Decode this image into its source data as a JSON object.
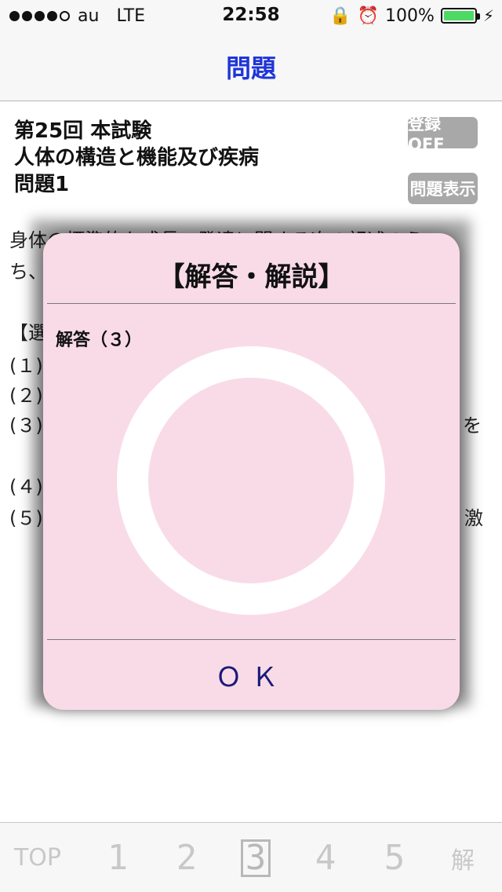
{
  "status_bar": {
    "carrier": "au",
    "network": "LTE",
    "time": "22:58",
    "battery_percent": "100%",
    "signal_bars_filled": 4,
    "signal_bars_total": 5
  },
  "nav": {
    "title": "問題"
  },
  "question": {
    "line1": "第25回 本試験",
    "line2": "人体の構造と機能及び疾病",
    "line3": "問題1",
    "register_button": "登録 OFF",
    "show_button": "問題表示",
    "body_line1": "身体の標準的な成長・発達に関する次の記述のう",
    "body_line2": "ち、",
    "options_header": "【選",
    "opt1": "(１)",
    "opt2": "(２)",
    "opt3": "(３)",
    "opt3_tail": "を",
    "opt4": "(４)",
    "opt5": "(５)",
    "opt5_tail": "激"
  },
  "modal": {
    "title": "【解答・解説】",
    "answer": "解答（３）",
    "ok_label": "ＯＫ"
  },
  "tab_bar": {
    "top": "TOP",
    "n1": "1",
    "n2": "2",
    "n3": "3",
    "n4": "4",
    "n5": "5",
    "kai": "解"
  },
  "colors": {
    "nav_title": "#1f35d8",
    "modal_bg": "#f9dbe7",
    "battery": "#4cd964",
    "ok_text": "#1a1a7a"
  },
  "icons": [
    "orientation-lock-icon",
    "alarm-icon",
    "battery-icon",
    "charging-bolt-icon",
    "correct-circle-icon"
  ]
}
